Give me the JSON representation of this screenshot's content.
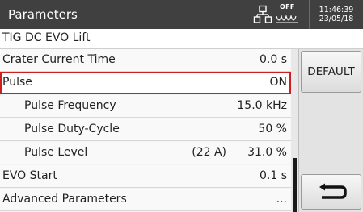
{
  "header": {
    "title": "Parameters",
    "status_off": "OFF",
    "time": "11:46:39",
    "date": "23/05/18"
  },
  "subtitle": "TIG DC EVO Lift",
  "rows": [
    {
      "label": "Crater Current Time",
      "value": "0.0 s",
      "extra": ""
    },
    {
      "label": "Pulse",
      "value": "ON",
      "extra": ""
    },
    {
      "label": "Pulse Frequency",
      "value": "15.0 kHz",
      "extra": ""
    },
    {
      "label": "Pulse Duty-Cycle",
      "value": "50 %",
      "extra": ""
    },
    {
      "label": "Pulse Level",
      "value": "31.0 %",
      "extra": "(22 A)"
    },
    {
      "label": "EVO Start",
      "value": "0.1 s",
      "extra": ""
    },
    {
      "label": "Advanced Parameters",
      "value": "...",
      "extra": ""
    }
  ],
  "buttons": {
    "default_label": "DEFAULT",
    "back_icon": "return-arrow-icon"
  },
  "icons": {
    "network": "network-icon",
    "off_status": "arc-off-icon"
  },
  "colors": {
    "header_bg": "#404040",
    "selection_border": "#cc1f1f"
  }
}
